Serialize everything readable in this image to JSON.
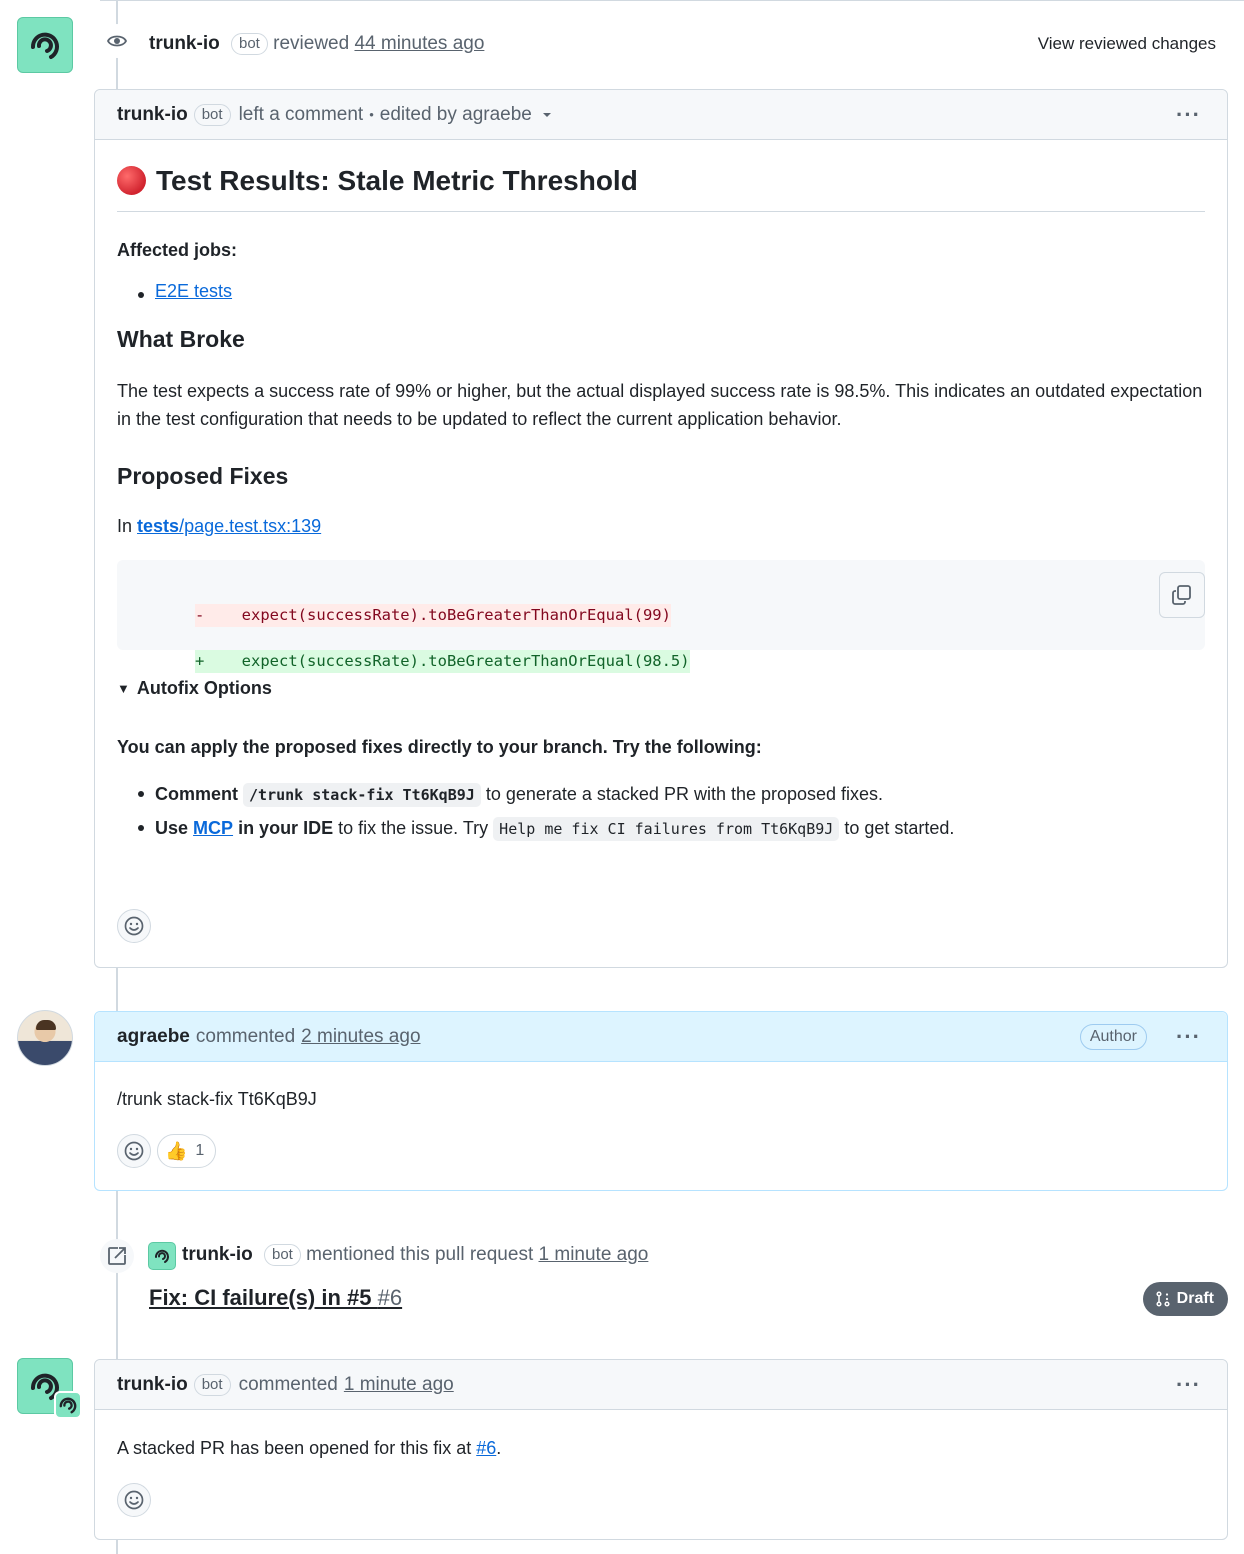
{
  "review_event": {
    "author": "trunk-io",
    "badge": "bot",
    "action": "reviewed",
    "time": "44 minutes ago",
    "view_changes": "View reviewed changes"
  },
  "review_comment": {
    "author": "trunk-io",
    "badge": "bot",
    "action": "left a comment",
    "separator": "•",
    "edited": "edited by agraebe",
    "title": "Test Results: Stale Metric Threshold",
    "affected_jobs_label": "Affected jobs:",
    "jobs": [
      "E2E tests"
    ],
    "what_broke_heading": "What Broke",
    "what_broke_text": "The test expects a success rate of 99% or higher, but the actual displayed success rate is 98.5%. This indicates an outdated expectation in the test configuration that needs to be updated to reflect the current application behavior.",
    "proposed_fixes_heading": "Proposed Fixes",
    "file_prefix": "In",
    "file_dir": "tests",
    "file_rest": "/page.test.tsx:139",
    "diff_removed_sign": "-",
    "diff_removed": "    expect(successRate).toBeGreaterThanOrEqual(99)",
    "diff_added_sign": "+",
    "diff_added": "    expect(successRate).toBeGreaterThanOrEqual(98.5)",
    "autofix_summary": "Autofix Options",
    "autofix_intro": "You can apply the proposed fixes directly to your branch. Try the following:",
    "option1_bold": "Comment",
    "option1_code": "/trunk stack-fix Tt6KqB9J",
    "option1_rest": "to generate a stacked PR with the proposed fixes.",
    "option2_use": "Use",
    "option2_link": "MCP",
    "option2_ide": "in your IDE",
    "option2_mid": "to fix the issue. Try",
    "option2_code": "Help me fix CI failures from Tt6KqB9J",
    "option2_rest": "to get started."
  },
  "user_comment": {
    "author": "agraebe",
    "action": "commented",
    "time": "2 minutes ago",
    "role_badge": "Author",
    "body": "/trunk stack-fix Tt6KqB9J",
    "reaction_emoji": "👍",
    "reaction_count": "1"
  },
  "mention_event": {
    "author": "trunk-io",
    "badge": "bot",
    "action": "mentioned this pull request",
    "time": "1 minute ago",
    "pr_title": "Fix: CI failure(s) in #5",
    "pr_number": "#6",
    "status": "Draft"
  },
  "bot_comment": {
    "author": "trunk-io",
    "badge": "bot",
    "action": "commented",
    "time": "1 minute ago",
    "body_prefix": "A stacked PR has been opened for this fix at",
    "body_link": "#6",
    "body_suffix": "."
  },
  "colors": {
    "link": "#0969da",
    "bot_avatar": "#7fe3c0",
    "error_dot": "#d1242f",
    "draft_badge": "#59636e",
    "author_header_bg": "#ddf4ff"
  }
}
